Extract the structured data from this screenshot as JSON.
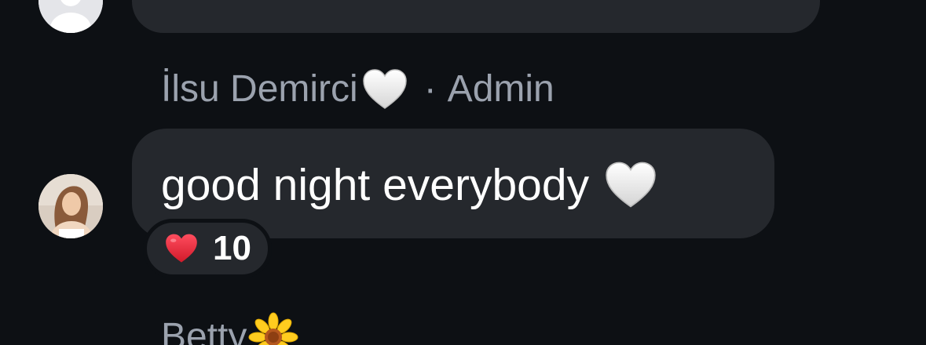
{
  "previous_message": {
    "avatar_icon": "default-user-avatar-icon"
  },
  "message": {
    "sender_name": "İlsu Demirci",
    "sender_emoji": "white-heart",
    "separator": "·",
    "sender_role": "Admin",
    "text": "good night everybody",
    "text_emoji": "white-heart",
    "reaction": {
      "emoji": "red-heart",
      "count": "10"
    }
  },
  "next_message": {
    "sender_name": "Betty",
    "sender_emoji": "sunflower"
  },
  "colors": {
    "background": "#0d1014",
    "bubble": "#25282d",
    "secondary_text": "#9ba2ae",
    "primary_text": "#ffffff",
    "heart_red": "#e3203a"
  }
}
